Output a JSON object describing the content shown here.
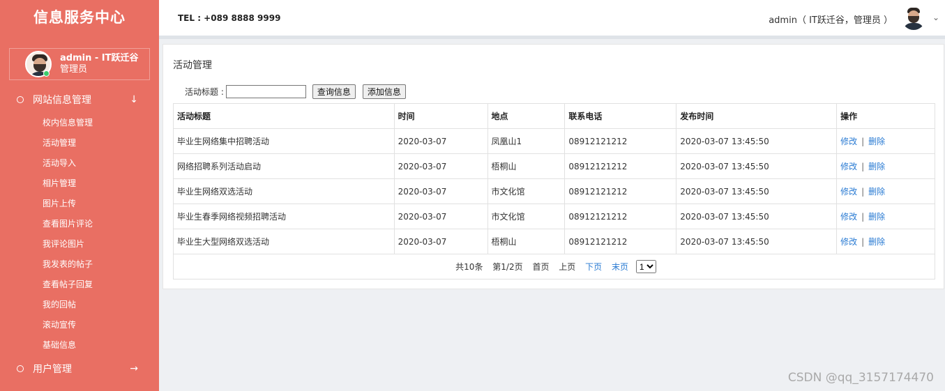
{
  "sidebar": {
    "brand": "信息服务中心",
    "profile": {
      "name": "admin - IT跃迁谷",
      "role": "管理员"
    },
    "menu1": {
      "label": "网站信息管理",
      "icon": "arrow-down-icon"
    },
    "items": [
      "校内信息管理",
      "活动管理",
      "活动导入",
      "相片管理",
      "图片上传",
      "查看图片评论",
      "我评论图片",
      "我发表的帖子",
      "查看帖子回复",
      "我的回帖",
      "滚动宣传",
      "基础信息"
    ],
    "menu2": {
      "label": "用户管理",
      "icon": "arrow-right-icon"
    }
  },
  "topbar": {
    "tel": "TEL : +089 8888 9999",
    "user": "admin（ IT跃迁谷，管理员 ）"
  },
  "main": {
    "title": "活动管理",
    "search": {
      "label": "活动标题 :",
      "value": "",
      "query_button": "查询信息",
      "add_button": "添加信息"
    },
    "columns": [
      "活动标题",
      "时间",
      "地点",
      "联系电话",
      "发布时间",
      "操作"
    ],
    "rows": [
      [
        "毕业生网络集中招聘活动",
        "2020-03-07",
        "凤凰山1",
        "08912121212",
        "2020-03-07 13:45:50"
      ],
      [
        "网络招聘系列活动启动",
        "2020-03-07",
        "梧桐山",
        "08912121212",
        "2020-03-07 13:45:50"
      ],
      [
        "毕业生网络双选活动",
        "2020-03-07",
        "市文化馆",
        "08912121212",
        "2020-03-07 13:45:50"
      ],
      [
        "毕业生春季网络视频招聘活动",
        "2020-03-07",
        "市文化馆",
        "08912121212",
        "2020-03-07 13:45:50"
      ],
      [
        "毕业生大型网络双选活动",
        "2020-03-07",
        "梧桐山",
        "08912121212",
        "2020-03-07 13:45:50"
      ]
    ],
    "actions": {
      "edit": "修改",
      "sep": "|",
      "delete": "删除"
    },
    "pager": {
      "total": "共10条",
      "page": "第1/2页",
      "first": "首页",
      "prev": "上页",
      "next": "下页",
      "last": "末页",
      "select_value": "1"
    }
  },
  "watermark": "CSDN @qq_3157174470"
}
